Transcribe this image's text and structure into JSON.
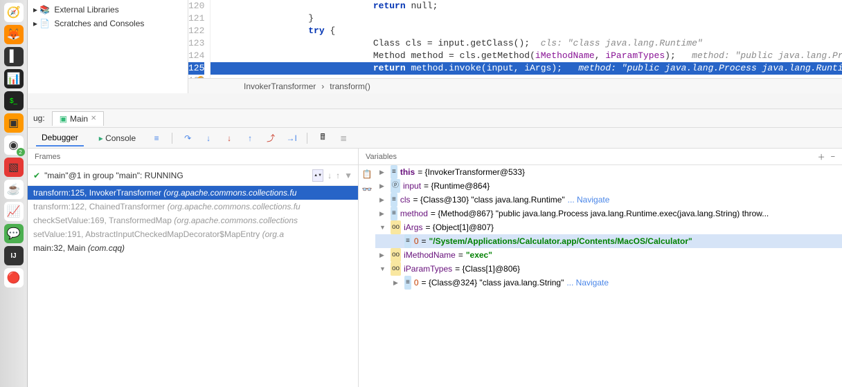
{
  "project_tree": {
    "external_libs": "External Libraries",
    "scratches": "Scratches and Consoles"
  },
  "editor": {
    "lines": [
      {
        "num": "120",
        "indent": 28,
        "html": "return null;",
        "tokens": [
          {
            "t": "return",
            "c": "kw"
          },
          {
            "t": " null;",
            "c": ""
          }
        ]
      },
      {
        "num": "121",
        "indent": 16,
        "html": "}"
      },
      {
        "num": "122",
        "indent": 16,
        "html": "try {",
        "tokens": [
          {
            "t": "try",
            "c": "kw"
          },
          {
            "t": " {",
            "c": ""
          }
        ]
      },
      {
        "num": "123",
        "indent": 28,
        "text": "Class cls = input.getClass();  ",
        "comment": "cls: \"class java.lang.Runtime\""
      },
      {
        "num": "124",
        "indent": 28,
        "text": "Method method = cls.getMethod(",
        "id1": "iMethodName",
        "mid": ", ",
        "id2": "iParamTypes",
        "end": ");   ",
        "comment": "method: \"public java.lang.Process java.lang.Runtime.ex"
      },
      {
        "num": "125",
        "indent": 28,
        "exec": true,
        "tokens": [
          {
            "t": "return",
            "c": "kw"
          },
          {
            "t": " method.in",
            "c": ""
          },
          {
            "t": "v",
            "c": ""
          },
          {
            "t": "oke(input, ",
            "c": ""
          },
          {
            "t": "iArgs",
            "c": "id"
          },
          {
            "t": ");   ",
            "c": ""
          }
        ],
        "comment": "method: \"public java.lang.Process java.lang.Runtime.exec(java.lang.String)"
      },
      {
        "num": "126",
        "indent": 16,
        "html": ""
      }
    ],
    "breadcrumb": [
      "InvokerTransformer",
      "transform()"
    ]
  },
  "debug_tab": {
    "ug_label": "ug:",
    "main": "Main"
  },
  "debugger_tabs": {
    "debugger": "Debugger",
    "console": "Console"
  },
  "thread": {
    "label": "\"main\"@1 in group \"main\": RUNNING"
  },
  "frames_header": "Frames",
  "vars_header": "Variables",
  "frames": [
    {
      "sel": true,
      "text": "transform:125, InvokerTransformer ",
      "pkg": "(org.apache.commons.collections.fu"
    },
    {
      "dim": true,
      "text": "transform:122, ChainedTransformer ",
      "pkg": "(org.apache.commons.collections.fu"
    },
    {
      "dim": true,
      "text": "checkSetValue:169, TransformedMap ",
      "pkg": "(org.apache.commons.collections"
    },
    {
      "dim": true,
      "text": "setValue:191, AbstractInputCheckedMapDecorator$MapEntry ",
      "pkg": "(org.a"
    },
    {
      "text": "main:32, Main ",
      "pkg": "(com.cqq)"
    }
  ],
  "variables": [
    {
      "depth": 0,
      "exp": "▶",
      "kind": "obj",
      "name": "this",
      "nameClass": "vk-this",
      "val": "= {InvokerTransformer@533}"
    },
    {
      "depth": 0,
      "exp": "▶",
      "kind": "param",
      "icon": "ⓟ",
      "name": "input",
      "val": "= {Runtime@864}"
    },
    {
      "depth": 0,
      "exp": "▶",
      "kind": "obj",
      "name": "cls",
      "val": "= {Class@130} \"class java.lang.Runtime\"",
      "link": "... Navigate"
    },
    {
      "depth": 0,
      "exp": "▶",
      "kind": "obj",
      "name": "method",
      "val": "= {Method@867} \"public java.lang.Process java.lang.Runtime.exec(java.lang.String) throw..."
    },
    {
      "depth": 0,
      "exp": "▼",
      "kind": "field",
      "icon": "oo",
      "name": "iArgs",
      "val": "= {Object[1]@807}"
    },
    {
      "depth": 1,
      "sel": true,
      "exp": "",
      "kind": "obj",
      "idx": "0",
      "val": "= ",
      "str": "\"/System/Applications/Calculator.app/Contents/MacOS/Calculator\""
    },
    {
      "depth": 0,
      "exp": "▶",
      "kind": "field",
      "icon": "oo",
      "name": "iMethodName",
      "val": "= ",
      "str": "\"exec\""
    },
    {
      "depth": 0,
      "exp": "▼",
      "kind": "field",
      "icon": "oo",
      "name": "iParamTypes",
      "val": "= {Class[1]@806}"
    },
    {
      "depth": 1,
      "exp": "▶",
      "kind": "obj",
      "idx": "0",
      "val": "= {Class@324} \"class java.lang.String\"",
      "link": "... Navigate"
    }
  ]
}
